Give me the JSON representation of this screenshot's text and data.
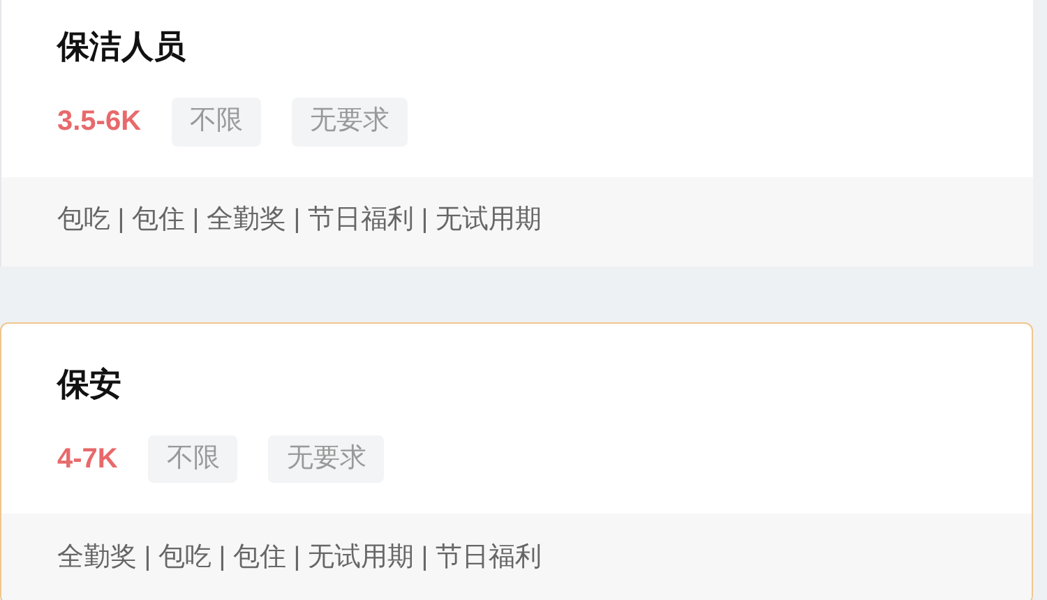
{
  "jobs": [
    {
      "title": "保洁人员",
      "salary": "3.5-6K",
      "tags": [
        "不限",
        "无要求"
      ],
      "benefits": "包吃 | 包住 | 全勤奖 | 节日福利 | 无试用期",
      "selected": false
    },
    {
      "title": "保安",
      "salary": "4-7K",
      "tags": [
        "不限",
        "无要求"
      ],
      "benefits": "全勤奖 | 包吃 | 包住 | 无试用期 | 节日福利",
      "selected": true
    }
  ]
}
